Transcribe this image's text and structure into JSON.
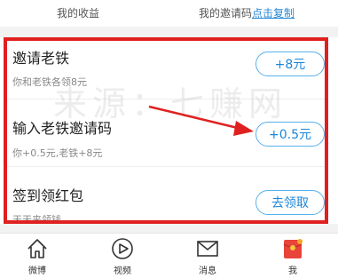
{
  "top": {
    "earnings_label": "我的收益",
    "invite_code_label": "我的邀请码",
    "copy_link": "点击复制"
  },
  "rows": [
    {
      "title": "邀请老铁",
      "desc": "你和老铁各领8元",
      "button": "+8元"
    },
    {
      "title": "输入老铁邀请码",
      "desc": "你+0.5元,老铁+8元",
      "button": "+0.5元"
    },
    {
      "title": "签到领红包",
      "desc": "天天来领钱",
      "button": "去领取"
    }
  ],
  "watermark": "来源：七赚网",
  "tabs": [
    {
      "label": "微博",
      "icon": "home-icon"
    },
    {
      "label": "视频",
      "icon": "play-icon"
    },
    {
      "label": "消息",
      "icon": "mail-icon"
    },
    {
      "label": "我",
      "icon": "red-envelope-icon"
    }
  ],
  "colors": {
    "highlight": "#e02020",
    "accent": "#1b86d8",
    "badge": "#f5a623",
    "envelope": "#e8443a"
  }
}
